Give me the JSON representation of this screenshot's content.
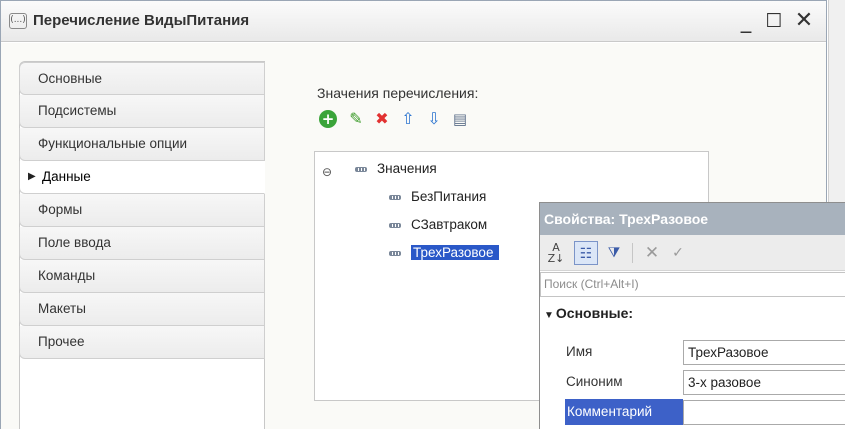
{
  "window": {
    "title": "Перечисление ВидыПитания",
    "title_icon": "(...)",
    "controls": {
      "minimize": "_",
      "maximize": "☐",
      "close": "✕"
    }
  },
  "tabs": [
    {
      "label": "Основные"
    },
    {
      "label": "Подсистемы"
    },
    {
      "label": "Функциональные опции"
    },
    {
      "label": "Данные",
      "active": true
    },
    {
      "label": "Формы"
    },
    {
      "label": "Поле ввода"
    },
    {
      "label": "Команды"
    },
    {
      "label": "Макеты"
    },
    {
      "label": "Прочее"
    }
  ],
  "values_panel": {
    "label": "Значения перечисления:",
    "toolbar_icons": [
      "add-icon",
      "edit-icon",
      "delete-icon",
      "move-up-icon",
      "move-down-icon",
      "list-icon"
    ],
    "tree": {
      "root": "Значения",
      "items": [
        "БезПитания",
        "СЗавтраком",
        "ТрехРазовое"
      ],
      "selected": "ТрехРазовое"
    }
  },
  "properties": {
    "title": "Свойства: ТрехРазовое",
    "search_placeholder": "Поиск (Ctrl+Alt+I)",
    "group": "Основные:",
    "rows": [
      {
        "name": "Имя",
        "value": "ТрехРазовое"
      },
      {
        "name": "Синоним",
        "value": "3-х разовое"
      },
      {
        "name": "Комментарий",
        "value": ""
      }
    ]
  }
}
